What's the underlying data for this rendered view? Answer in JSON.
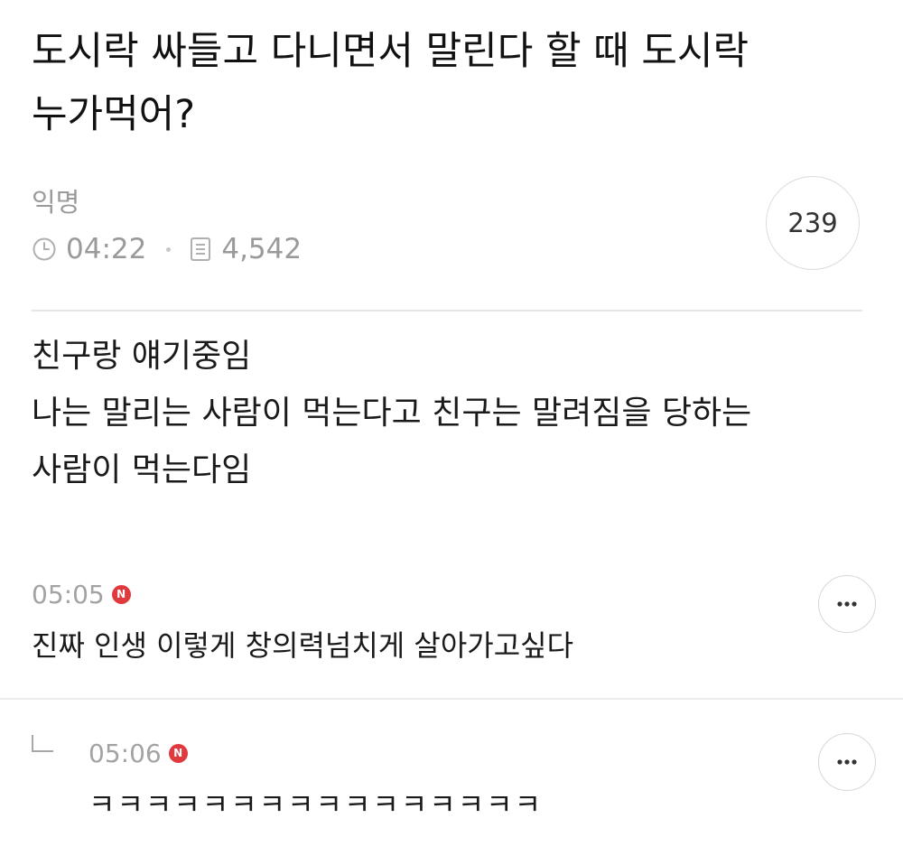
{
  "post": {
    "title_lines": [
      "도시락 싸들고 다니면서 말린다 할 때 도시락",
      "누가먹어?"
    ],
    "author": "익명",
    "time": "04:22",
    "views": "4,542",
    "comment_count": "239",
    "body_lines": [
      "친구랑 얘기중임",
      "나는 말리는 사람이 먹는다고 친구는 말려짐을 당하는",
      "사람이 먹는다임"
    ]
  },
  "comments": [
    {
      "time": "05:05",
      "badge": "N",
      "text": "진짜 인생 이렇게 창의력넘치게 살아가고싶다",
      "is_reply": false
    },
    {
      "time": "05:06",
      "badge": "N",
      "text": "ㅋㅋㅋㅋㅋㅋㅋㅋㅋㅋㅋㅋㅋㅋㅋㅋ",
      "is_reply": true
    }
  ],
  "icons": {
    "clock": "clock-icon",
    "views": "document-icon",
    "more": "more-dots-icon",
    "reply": "reply-arrow-icon",
    "new": "new-badge"
  },
  "colors": {
    "new_badge": "#e0393e",
    "meta_text": "#9a9a9a",
    "body_text": "#1a1a1a"
  }
}
